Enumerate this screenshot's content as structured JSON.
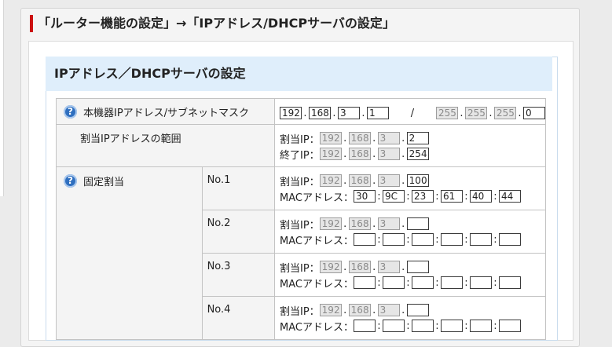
{
  "heading": "「ルーター機能の設定」→「IPアドレス/DHCPサーバの設定」",
  "section_title": "IPアドレス／DHCPサーバの設定",
  "help_icon_glyph": "?",
  "device_ip": {
    "label": "本機器IPアドレス/サブネットマスク",
    "ip": [
      "192",
      "168",
      "3",
      "1"
    ],
    "separator": "/",
    "mask": [
      "255",
      "255",
      "255",
      "0"
    ]
  },
  "assign_range": {
    "label": "割当IPアドレスの範囲",
    "start_label": "割当IP：",
    "start": [
      "192",
      "168",
      "3",
      "2"
    ],
    "end_label": "終了IP：",
    "end": [
      "192",
      "168",
      "3",
      "254"
    ]
  },
  "fixed": {
    "label": "固定割当",
    "ip_label": "割当IP：",
    "mac_label": "MACアドレス：",
    "entries": [
      {
        "no": "No.1",
        "ip": [
          "192",
          "168",
          "3",
          "100"
        ],
        "mac": [
          "30",
          "9C",
          "23",
          "61",
          "40",
          "44"
        ]
      },
      {
        "no": "No.2",
        "ip": [
          "192",
          "168",
          "3",
          ""
        ],
        "mac": [
          "",
          "",
          "",
          "",
          "",
          ""
        ]
      },
      {
        "no": "No.3",
        "ip": [
          "192",
          "168",
          "3",
          ""
        ],
        "mac": [
          "",
          "",
          "",
          "",
          "",
          ""
        ]
      },
      {
        "no": "No.4",
        "ip": [
          "192",
          "168",
          "3",
          ""
        ],
        "mac": [
          "",
          "",
          "",
          "",
          "",
          ""
        ]
      }
    ]
  }
}
